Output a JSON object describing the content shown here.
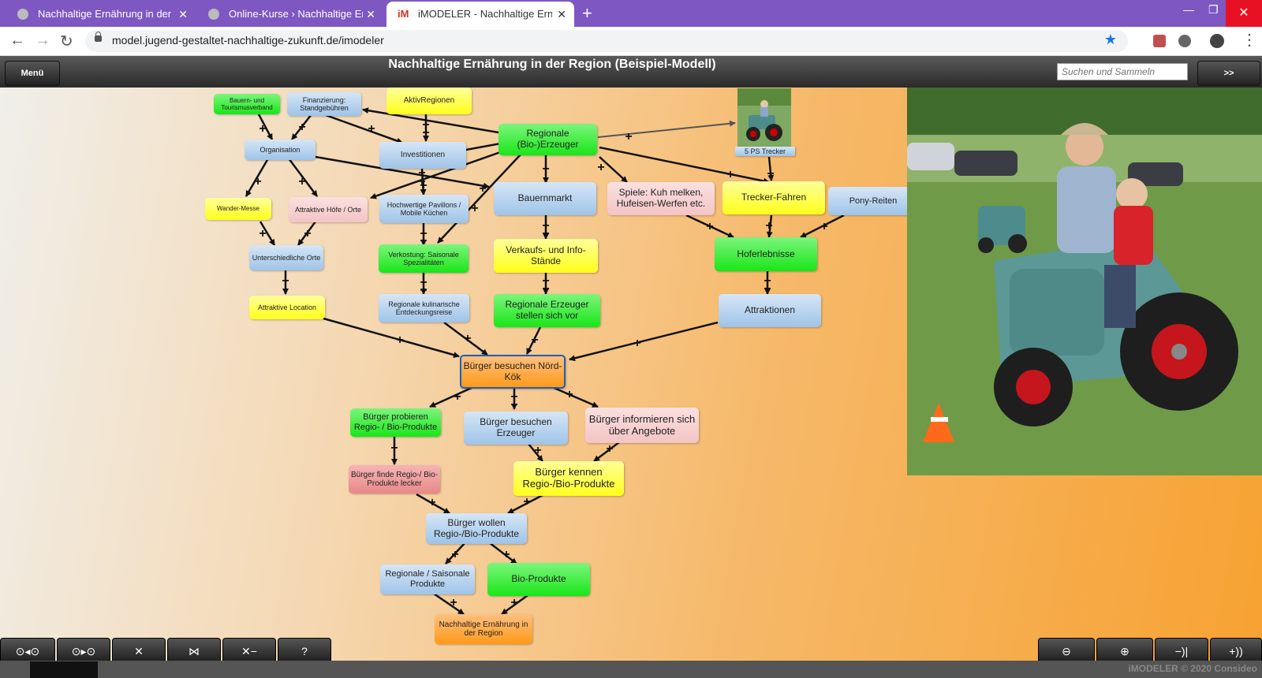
{
  "browser": {
    "tabs": [
      {
        "title": "Nachhaltige Ernährung in der Re"
      },
      {
        "title": "Online-Kurse › Nachhaltige Ernä"
      },
      {
        "title": "iMODELER - Nachhaltige Ernähru",
        "favicon": "iM"
      }
    ],
    "url": "model.jugend-gestaltet-nachhaltige-zukunft.de/imodeler"
  },
  "app": {
    "menu_label": "Menü",
    "title": "Nachhaltige Ernährung in der Region (Beispiel-Modell)",
    "search_placeholder": "Suchen und Sammeln",
    "go_label": ">>",
    "copyright": "iMODELER © 2020 Consideo",
    "help_label": "?"
  },
  "nodes": {
    "n1": "Bauern- und Tourismusverband",
    "n2": "Finanzierung: Standgebühren",
    "n3": "AktivRegionen",
    "n4": "Regionale (Bio-)Erzeuger",
    "n5": "Organisation",
    "n6": "Investitionen",
    "n7": "5 PS Trecker",
    "n8": "Wander-Messe",
    "n9": "Attraktive Höfe / Orte",
    "n10": "Hochwertige Pavillons / Mobile Küchen",
    "n11": "Bauernmarkt",
    "n12": "Spiele: Kuh melken, Hufeisen-Werfen etc.",
    "n13": "Trecker-Fahren",
    "n14": "Pony-Reiten",
    "n15": "Unterschiedliche Orte",
    "n16": "Verkostung: Saisonale Spezialitäten",
    "n17": "Verkaufs- und Info-Stände",
    "n18": "Hoferlebnisse",
    "n19": "Attraktive Location",
    "n20": "Regionale kulinarische Entdeckungsreise",
    "n21": "Regionale Erzeuger stellen sich vor",
    "n22": "Attraktionen",
    "n23": "Bürger besuchen Nörd-Kök",
    "n24": "Bürger probieren Regio- / Bio-Produkte",
    "n25": "Bürger besuchen Erzeuger",
    "n26": "Bürger informieren sich über Angebote",
    "n27": "Bürger finde Regio-/ Bio-Produkte lecker",
    "n28": "Bürger kennen Regio-/Bio-Produkte",
    "n29": "Bürger wollen Regio-/Bio-Produkte",
    "n30": "Regionale / Saisonale Produkte",
    "n31": "Bio-Produkte",
    "n32": "Nachhaltige Ernährung in der Region"
  },
  "edge_sign": "+",
  "colors": {
    "accent": "#7e57c2",
    "green": "#19e619",
    "yellow": "#ffff1a",
    "blue": "#9fc4e8",
    "orange": "#ff9a1a"
  }
}
